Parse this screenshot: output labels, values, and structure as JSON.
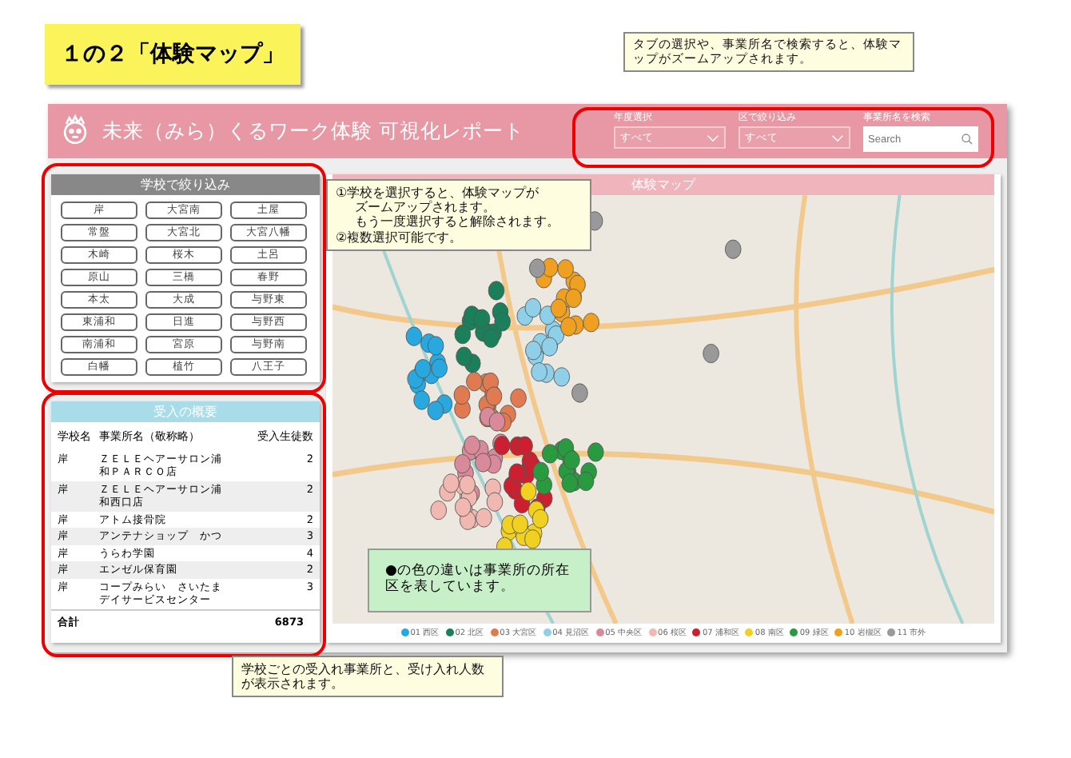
{
  "page_title": "１の２「体験マップ」",
  "top_callout": "タブの選択や、事業所名で検索すると、体験マップがズームアップされます。",
  "header": {
    "title": "未来（みら）くるワーク体験 可視化レポート",
    "filters": [
      {
        "label": "年度選択",
        "value": "すべて",
        "kind": "dropdown"
      },
      {
        "label": "区で絞り込み",
        "value": "すべて",
        "kind": "dropdown"
      },
      {
        "label": "事業所名を検索",
        "placeholder": "Search",
        "kind": "search"
      }
    ]
  },
  "school_filter": {
    "title": "学校で絞り込み",
    "schools": [
      {
        "label": "岸",
        "selected": false
      },
      {
        "label": "大宮南",
        "selected": false
      },
      {
        "label": "土屋",
        "selected": false
      },
      {
        "label": "常盤",
        "selected": false
      },
      {
        "label": "大宮北",
        "selected": false
      },
      {
        "label": "大宮八幡",
        "selected": false
      },
      {
        "label": "木崎",
        "selected": false
      },
      {
        "label": "桜木",
        "selected": false
      },
      {
        "label": "土呂",
        "selected": false
      },
      {
        "label": "原山",
        "selected": false
      },
      {
        "label": "三橋",
        "selected": false
      },
      {
        "label": "春野",
        "selected": false
      },
      {
        "label": "本太",
        "selected": false
      },
      {
        "label": "大成",
        "selected": false
      },
      {
        "label": "与野東",
        "selected": false
      },
      {
        "label": "東浦和",
        "selected": false
      },
      {
        "label": "日進",
        "selected": false
      },
      {
        "label": "与野西",
        "selected": false
      },
      {
        "label": "南浦和",
        "selected": false
      },
      {
        "label": "宮原",
        "selected": false
      },
      {
        "label": "与野南",
        "selected": false
      },
      {
        "label": "白幡",
        "selected": false
      },
      {
        "label": "植竹",
        "selected": false
      },
      {
        "label": "八王子",
        "selected": false
      }
    ]
  },
  "summary": {
    "title": "受入の概要",
    "columns": [
      "学校名",
      "事業所名（敬称略）",
      "受入生徒数"
    ],
    "rows": [
      {
        "school": "岸",
        "office": "ＺＥＬＥヘアーサロン浦和ＰＡＲＣＯ店",
        "count": "2"
      },
      {
        "school": "岸",
        "office": "ＺＥＬＥヘアーサロン浦和西口店",
        "count": "2"
      },
      {
        "school": "岸",
        "office": "アトム接骨院",
        "count": "2"
      },
      {
        "school": "岸",
        "office": "アンテナショップ　かつ",
        "count": "3"
      },
      {
        "school": "岸",
        "office": "うらわ学園",
        "count": "4"
      },
      {
        "school": "岸",
        "office": "エンゼル保育園",
        "count": "2"
      },
      {
        "school": "岸",
        "office": "コープみらい　さいたまデイサービスセンター",
        "count": "3"
      }
    ],
    "total_label": "合計",
    "total": "6873"
  },
  "map": {
    "title": "体験マップ",
    "legend": [
      {
        "label": "01 西区",
        "color": "#29a8e0"
      },
      {
        "label": "02 北区",
        "color": "#1a7f5a"
      },
      {
        "label": "03 大宮区",
        "color": "#e07a50"
      },
      {
        "label": "04 見沼区",
        "color": "#8fd0e8"
      },
      {
        "label": "05 中央区",
        "color": "#d98a9a"
      },
      {
        "label": "06 桜区",
        "color": "#f0b8b0"
      },
      {
        "label": "07 浦和区",
        "color": "#cc2030"
      },
      {
        "label": "08 南区",
        "color": "#f0d020"
      },
      {
        "label": "09 緑区",
        "color": "#2a9a40"
      },
      {
        "label": "10 岩槻区",
        "color": "#f0a020"
      },
      {
        "label": "11 市外",
        "color": "#999999"
      }
    ]
  },
  "map_callout": [
    "①学校を選択すると、体験マップが",
    "ズームアップされます。",
    "もう一度選択すると解除されます。",
    "②複数選択可能です。"
  ],
  "map_note": "●の色の違いは事業所の所在区を表しています。",
  "bottom_callout": "学校ごとの受入れ事業所と、受け入れ人数が表示されます。"
}
